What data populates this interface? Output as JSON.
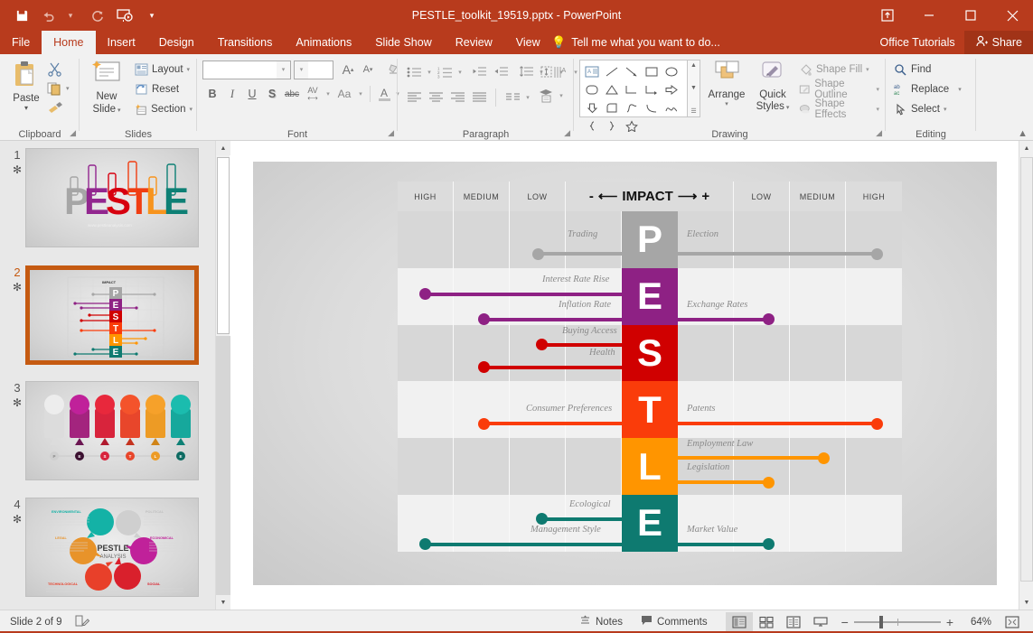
{
  "window": {
    "title": "PESTLE_toolkit_19519.pptx - PowerPoint",
    "accent_color": "#B83B1D",
    "quick_access": [
      {
        "name": "save-icon",
        "label": "Save"
      },
      {
        "name": "undo-icon",
        "label": "Undo"
      },
      {
        "name": "redo-icon",
        "label": "Redo"
      },
      {
        "name": "start-presentation-icon",
        "label": "Start From Beginning"
      },
      {
        "name": "customize-qat-icon",
        "label": "Customize Quick Access Toolbar"
      }
    ],
    "controls": [
      {
        "name": "ribbon-display-options",
        "glyph": "⤓"
      },
      {
        "name": "minimize-button",
        "glyph": "–"
      },
      {
        "name": "maximize-button",
        "glyph": "☐"
      },
      {
        "name": "close-button",
        "glyph": "✕"
      }
    ]
  },
  "tabs": [
    {
      "label": "File",
      "active": false
    },
    {
      "label": "Home",
      "active": true
    },
    {
      "label": "Insert",
      "active": false
    },
    {
      "label": "Design",
      "active": false
    },
    {
      "label": "Transitions",
      "active": false
    },
    {
      "label": "Animations",
      "active": false
    },
    {
      "label": "Slide Show",
      "active": false
    },
    {
      "label": "Review",
      "active": false
    },
    {
      "label": "View",
      "active": false
    }
  ],
  "tell_me": "Tell me what you want to do...",
  "office_tutorials": "Office Tutorials",
  "share": "Share",
  "ribbon": {
    "clipboard": {
      "label": "Clipboard",
      "paste": "Paste",
      "cut": "Cut",
      "copy": "Copy",
      "format_painter": "Format Painter"
    },
    "slides": {
      "label": "Slides",
      "new_slide": "New\nSlide",
      "new_slide_line1": "New",
      "new_slide_line2": "Slide",
      "layout": "Layout",
      "reset": "Reset",
      "section": "Section"
    },
    "font": {
      "label": "Font",
      "font_name": "",
      "font_name_placeholder": "",
      "font_size": "",
      "grow": "A",
      "shrink": "A",
      "clear_formatting": "Clear All Formatting",
      "bold": "B",
      "italic": "I",
      "underline": "U",
      "shadow": "S",
      "strikethrough": "abc",
      "character_spacing": "AV",
      "change_case": "Aa",
      "font_color": "A"
    },
    "paragraph": {
      "label": "Paragraph"
    },
    "drawing": {
      "label": "Drawing",
      "arrange": "Arrange",
      "quick_styles_line1": "Quick",
      "quick_styles_line2": "Styles",
      "shape_fill": "Shape Fill",
      "shape_outline": "Shape Outline",
      "shape_effects": "Shape Effects"
    },
    "editing": {
      "label": "Editing",
      "find": "Find",
      "replace": "Replace",
      "select": "Select"
    }
  },
  "thumbnails": [
    {
      "number": "1",
      "star": "✻",
      "selected": false,
      "kind": "title"
    },
    {
      "number": "2",
      "star": "✻",
      "selected": true,
      "kind": "matrix"
    },
    {
      "number": "3",
      "star": "✻",
      "selected": false,
      "kind": "pins"
    },
    {
      "number": "4",
      "star": "✻",
      "selected": false,
      "kind": "circle"
    }
  ],
  "thumb1": {
    "letters": [
      "P",
      "E",
      "S",
      "T",
      "L",
      "E"
    ],
    "colors": [
      "#A6A6A6",
      "#92278F",
      "#D7000F",
      "#F03E12",
      "#F7941E",
      "#0E8075"
    ],
    "tag_labels": [
      "POLITICAL",
      "ECONOMICAL",
      "SOCIAL",
      "TECHNOLOGICAL",
      "LEGAL",
      "ENVIRONMENTAL"
    ]
  },
  "thumb3": {
    "letters": [
      "P",
      "E",
      "S",
      "T",
      "L",
      "E"
    ],
    "colors": [
      "#D6D6D6",
      "#C0219A",
      "#E8283C",
      "#F4532B",
      "#F6A12A",
      "#1BBCAE"
    ]
  },
  "thumb4": {
    "center_line1": "PESTLE",
    "center_line2": "ANALYSIS",
    "labels": [
      "ENVIRONMENTAL",
      "POLITICAL",
      "ECONOMICAL",
      "SOCIAL",
      "TECHNOLOGICAL",
      "LEGAL"
    ],
    "colors": [
      "#14B2A6",
      "#C9C9C9",
      "#C0219A",
      "#D9202C",
      "#E8402A",
      "#E8932A"
    ]
  },
  "slide": {
    "header": {
      "left": [
        "HIGH",
        "MEDIUM",
        "LOW"
      ],
      "impact_minus": "-",
      "impact_label": "IMPACT",
      "impact_plus": "+",
      "arrow_left": "⟵",
      "arrow_right": "⟶",
      "right": [
        "LOW",
        "MEDIUM",
        "HIGH"
      ]
    },
    "rows": [
      {
        "letter": "P",
        "color": "#A6A6A6",
        "items": [
          {
            "label": "Trading",
            "side": "left",
            "value": -1.05
          },
          {
            "label": "Election",
            "side": "right",
            "value": 2.95
          }
        ]
      },
      {
        "letter": "E",
        "color": "#8E2184",
        "items": [
          {
            "label": "Interest Rate Rise",
            "side": "left",
            "value": -3.45
          },
          {
            "label": "Inflation Rate",
            "side": "left",
            "value": -2.45
          },
          {
            "label": "Exchange Rates",
            "side": "right",
            "value": 1.45
          }
        ]
      },
      {
        "letter": "S",
        "color": "#D00000",
        "items": [
          {
            "label": "Buying Access",
            "side": "left",
            "value": -1.45
          },
          {
            "label": "Health",
            "side": "left",
            "value": -2.45
          }
        ]
      },
      {
        "letter": "T",
        "color": "#FA3C0A",
        "items": [
          {
            "label": "Consumer Preferences",
            "side": "left",
            "value": -2.45
          },
          {
            "label": "Patents",
            "side": "right",
            "value": 2.95
          }
        ]
      },
      {
        "letter": "L",
        "color": "#FF9500",
        "items": [
          {
            "label": "Employment Law",
            "side": "right",
            "value": 2.45
          },
          {
            "label": "Legislation",
            "side": "right",
            "value": 1.45
          }
        ]
      },
      {
        "letter": "E",
        "color": "#0E7A70",
        "items": [
          {
            "label": "Ecological",
            "side": "left",
            "value": -1.45
          },
          {
            "label": "Management Style",
            "side": "left",
            "value": -3.95
          },
          {
            "label": "Market Value",
            "side": "right",
            "value": 1.45
          }
        ]
      }
    ]
  },
  "status": {
    "slide_counter": "Slide 2 of 9",
    "notes": "Notes",
    "comments": "Comments",
    "zoom_percent": "64%",
    "views": [
      {
        "name": "normal-view",
        "active": true
      },
      {
        "name": "slide-sorter-view",
        "active": false
      },
      {
        "name": "reading-view",
        "active": false
      },
      {
        "name": "slide-show-view",
        "active": false
      }
    ]
  }
}
